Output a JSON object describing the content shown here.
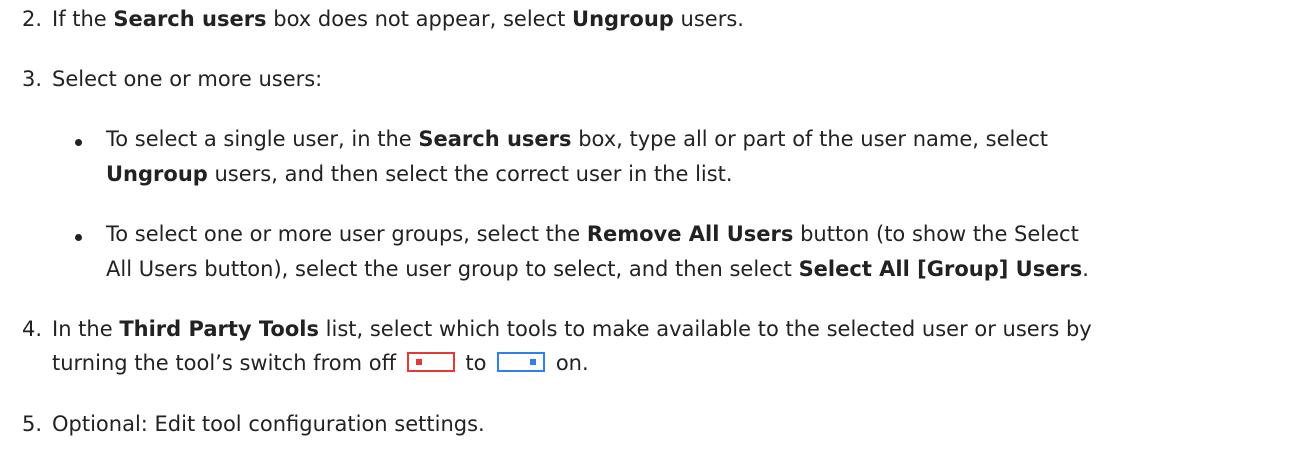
{
  "steps": [
    {
      "number": "2.",
      "t1": "If the ",
      "b1": "Search users",
      "t2": " box does not appear, select ",
      "b2": "Ungroup",
      "t3": " users."
    },
    {
      "number": "3.",
      "t1": "Select one or more users:"
    },
    {
      "number": "4.",
      "t1": "In the ",
      "b1": "Third Party Tools",
      "t2": " list, select which tools to make available to the selected user or users by",
      "line2_t1": "turning the tool’s switch from off ",
      "line2_t2": " to ",
      "line2_t3": " on."
    },
    {
      "number": "5.",
      "t1": "Optional: Edit tool configuration settings."
    }
  ],
  "bullets": [
    {
      "line1_t1": "To select a single user, in the ",
      "line1_b1": "Search users",
      "line1_t2": " box, type all or part of the user name, select",
      "line2_b1": "Ungroup",
      "line2_t1": " users, and then select the correct user in the list."
    },
    {
      "line1_t1": "To select one or more user groups, select the ",
      "line1_b1": "Remove All Users",
      "line1_t2": " button (to show the Select",
      "line2_t1": "All Users button), select the user group to select, and then select ",
      "line2_b1": "Select All [Group] Users",
      "line2_t2": "."
    }
  ],
  "toggles": {
    "off_color": "#e53935",
    "on_color": "#2f80ed",
    "off_state": "off",
    "on_state": "on"
  }
}
